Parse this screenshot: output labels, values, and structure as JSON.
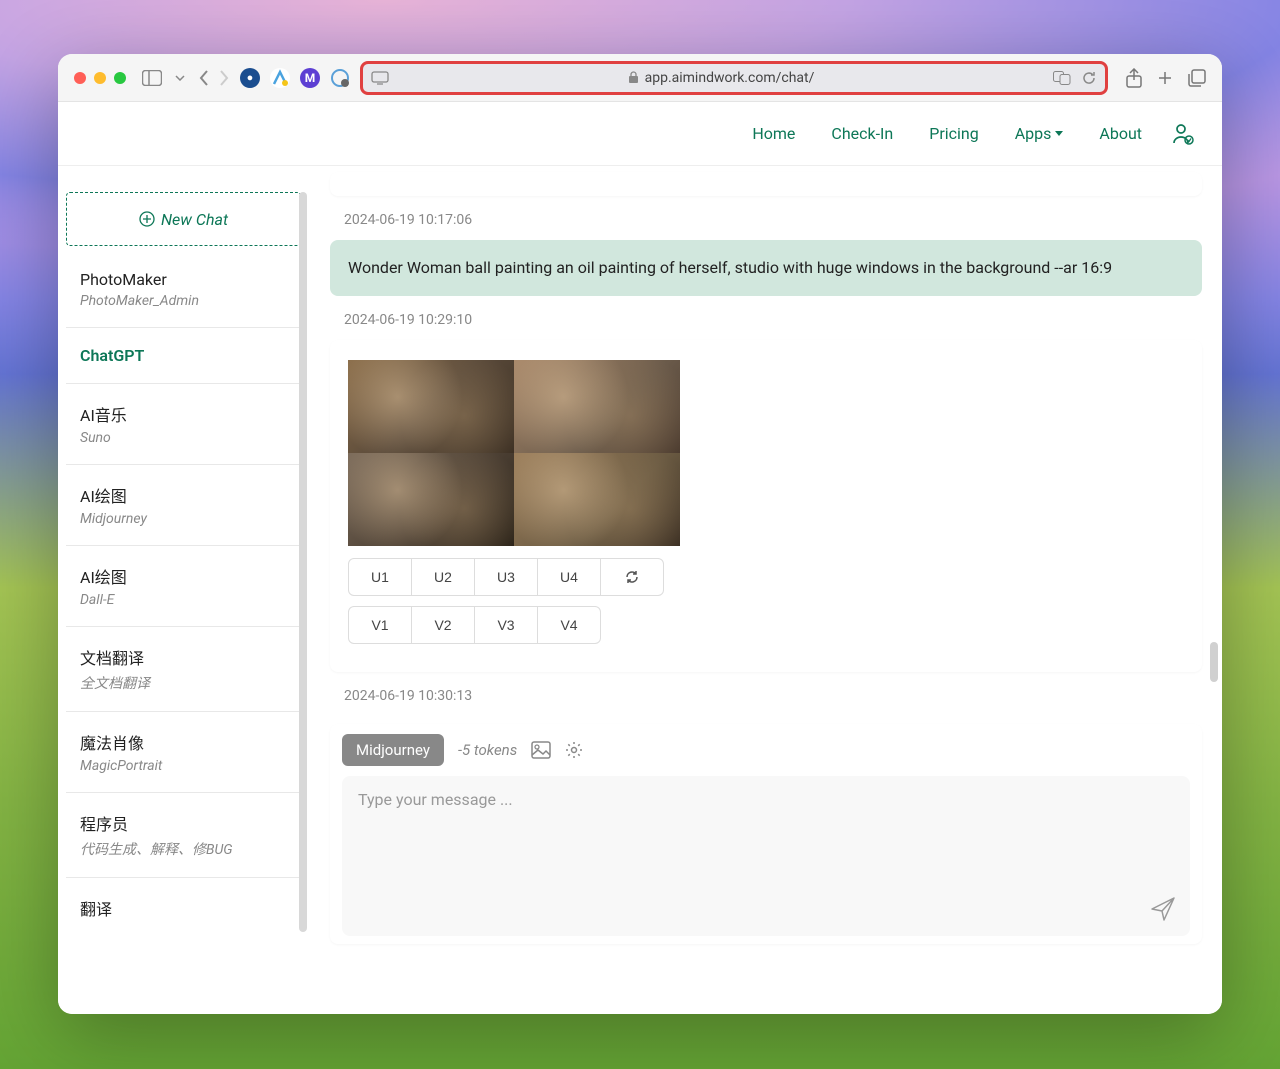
{
  "browser": {
    "url_host": "app.aimindwork.com/chat/"
  },
  "topnav": {
    "items": [
      "Home",
      "Check-In",
      "Pricing",
      "Apps",
      "About"
    ]
  },
  "sidebar": {
    "new_chat_label": "New Chat",
    "items": [
      {
        "title": "PhotoMaker",
        "sub": "PhotoMaker_Admin"
      },
      {
        "title": "ChatGPT",
        "sub": ""
      },
      {
        "title": "AI音乐",
        "sub": "Suno"
      },
      {
        "title": "AI绘图",
        "sub": "Midjourney"
      },
      {
        "title": "AI绘图",
        "sub": "Dall-E"
      },
      {
        "title": "文档翻译",
        "sub": "全文档翻译"
      },
      {
        "title": "魔法肖像",
        "sub": "MagicPortrait"
      },
      {
        "title": "程序员",
        "sub": "代码生成、解释、修BUG"
      },
      {
        "title": "翻译",
        "sub": ""
      }
    ],
    "active_index": 1
  },
  "chat": {
    "timestamps": {
      "ts0": "2024-06-19 10:17:06",
      "ts1": "2024-06-19 10:29:10",
      "ts2": "2024-06-19 10:30:13"
    },
    "user_message": "Wonder Woman ball painting an oil painting of herself, studio with huge windows in the background --ar 16:9",
    "upscale_buttons": [
      "U1",
      "U2",
      "U3",
      "U4"
    ],
    "variation_buttons": [
      "V1",
      "V2",
      "V3",
      "V4"
    ]
  },
  "input": {
    "model_label": "Midjourney",
    "token_cost": "-5 tokens",
    "placeholder": "Type your message ..."
  },
  "colors": {
    "accent": "#0d7757",
    "addr_highlight": "#e04040"
  }
}
